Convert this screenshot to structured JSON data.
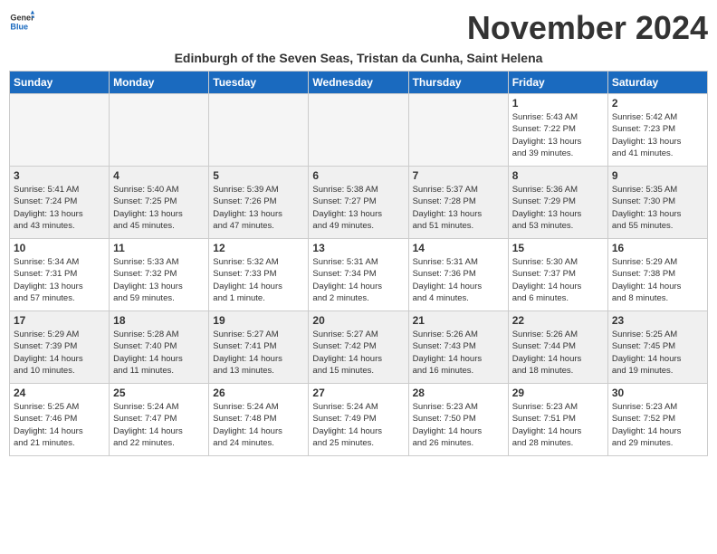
{
  "logo": {
    "line1": "General",
    "line2": "Blue"
  },
  "title": "November 2024",
  "subtitle": "Edinburgh of the Seven Seas, Tristan da Cunha, Saint Helena",
  "days_of_week": [
    "Sunday",
    "Monday",
    "Tuesday",
    "Wednesday",
    "Thursday",
    "Friday",
    "Saturday"
  ],
  "weeks": [
    [
      {
        "day": "",
        "info": "",
        "shaded": true
      },
      {
        "day": "",
        "info": "",
        "shaded": true
      },
      {
        "day": "",
        "info": "",
        "shaded": true
      },
      {
        "day": "",
        "info": "",
        "shaded": true
      },
      {
        "day": "",
        "info": "",
        "shaded": true
      },
      {
        "day": "1",
        "info": "Sunrise: 5:43 AM\nSunset: 7:22 PM\nDaylight: 13 hours\nand 39 minutes.",
        "shaded": false
      },
      {
        "day": "2",
        "info": "Sunrise: 5:42 AM\nSunset: 7:23 PM\nDaylight: 13 hours\nand 41 minutes.",
        "shaded": false
      }
    ],
    [
      {
        "day": "3",
        "info": "Sunrise: 5:41 AM\nSunset: 7:24 PM\nDaylight: 13 hours\nand 43 minutes.",
        "shaded": true
      },
      {
        "day": "4",
        "info": "Sunrise: 5:40 AM\nSunset: 7:25 PM\nDaylight: 13 hours\nand 45 minutes.",
        "shaded": true
      },
      {
        "day": "5",
        "info": "Sunrise: 5:39 AM\nSunset: 7:26 PM\nDaylight: 13 hours\nand 47 minutes.",
        "shaded": true
      },
      {
        "day": "6",
        "info": "Sunrise: 5:38 AM\nSunset: 7:27 PM\nDaylight: 13 hours\nand 49 minutes.",
        "shaded": true
      },
      {
        "day": "7",
        "info": "Sunrise: 5:37 AM\nSunset: 7:28 PM\nDaylight: 13 hours\nand 51 minutes.",
        "shaded": true
      },
      {
        "day": "8",
        "info": "Sunrise: 5:36 AM\nSunset: 7:29 PM\nDaylight: 13 hours\nand 53 minutes.",
        "shaded": true
      },
      {
        "day": "9",
        "info": "Sunrise: 5:35 AM\nSunset: 7:30 PM\nDaylight: 13 hours\nand 55 minutes.",
        "shaded": true
      }
    ],
    [
      {
        "day": "10",
        "info": "Sunrise: 5:34 AM\nSunset: 7:31 PM\nDaylight: 13 hours\nand 57 minutes.",
        "shaded": false
      },
      {
        "day": "11",
        "info": "Sunrise: 5:33 AM\nSunset: 7:32 PM\nDaylight: 13 hours\nand 59 minutes.",
        "shaded": false
      },
      {
        "day": "12",
        "info": "Sunrise: 5:32 AM\nSunset: 7:33 PM\nDaylight: 14 hours\nand 1 minute.",
        "shaded": false
      },
      {
        "day": "13",
        "info": "Sunrise: 5:31 AM\nSunset: 7:34 PM\nDaylight: 14 hours\nand 2 minutes.",
        "shaded": false
      },
      {
        "day": "14",
        "info": "Sunrise: 5:31 AM\nSunset: 7:36 PM\nDaylight: 14 hours\nand 4 minutes.",
        "shaded": false
      },
      {
        "day": "15",
        "info": "Sunrise: 5:30 AM\nSunset: 7:37 PM\nDaylight: 14 hours\nand 6 minutes.",
        "shaded": false
      },
      {
        "day": "16",
        "info": "Sunrise: 5:29 AM\nSunset: 7:38 PM\nDaylight: 14 hours\nand 8 minutes.",
        "shaded": false
      }
    ],
    [
      {
        "day": "17",
        "info": "Sunrise: 5:29 AM\nSunset: 7:39 PM\nDaylight: 14 hours\nand 10 minutes.",
        "shaded": true
      },
      {
        "day": "18",
        "info": "Sunrise: 5:28 AM\nSunset: 7:40 PM\nDaylight: 14 hours\nand 11 minutes.",
        "shaded": true
      },
      {
        "day": "19",
        "info": "Sunrise: 5:27 AM\nSunset: 7:41 PM\nDaylight: 14 hours\nand 13 minutes.",
        "shaded": true
      },
      {
        "day": "20",
        "info": "Sunrise: 5:27 AM\nSunset: 7:42 PM\nDaylight: 14 hours\nand 15 minutes.",
        "shaded": true
      },
      {
        "day": "21",
        "info": "Sunrise: 5:26 AM\nSunset: 7:43 PM\nDaylight: 14 hours\nand 16 minutes.",
        "shaded": true
      },
      {
        "day": "22",
        "info": "Sunrise: 5:26 AM\nSunset: 7:44 PM\nDaylight: 14 hours\nand 18 minutes.",
        "shaded": true
      },
      {
        "day": "23",
        "info": "Sunrise: 5:25 AM\nSunset: 7:45 PM\nDaylight: 14 hours\nand 19 minutes.",
        "shaded": true
      }
    ],
    [
      {
        "day": "24",
        "info": "Sunrise: 5:25 AM\nSunset: 7:46 PM\nDaylight: 14 hours\nand 21 minutes.",
        "shaded": false
      },
      {
        "day": "25",
        "info": "Sunrise: 5:24 AM\nSunset: 7:47 PM\nDaylight: 14 hours\nand 22 minutes.",
        "shaded": false
      },
      {
        "day": "26",
        "info": "Sunrise: 5:24 AM\nSunset: 7:48 PM\nDaylight: 14 hours\nand 24 minutes.",
        "shaded": false
      },
      {
        "day": "27",
        "info": "Sunrise: 5:24 AM\nSunset: 7:49 PM\nDaylight: 14 hours\nand 25 minutes.",
        "shaded": false
      },
      {
        "day": "28",
        "info": "Sunrise: 5:23 AM\nSunset: 7:50 PM\nDaylight: 14 hours\nand 26 minutes.",
        "shaded": false
      },
      {
        "day": "29",
        "info": "Sunrise: 5:23 AM\nSunset: 7:51 PM\nDaylight: 14 hours\nand 28 minutes.",
        "shaded": false
      },
      {
        "day": "30",
        "info": "Sunrise: 5:23 AM\nSunset: 7:52 PM\nDaylight: 14 hours\nand 29 minutes.",
        "shaded": false
      }
    ]
  ]
}
